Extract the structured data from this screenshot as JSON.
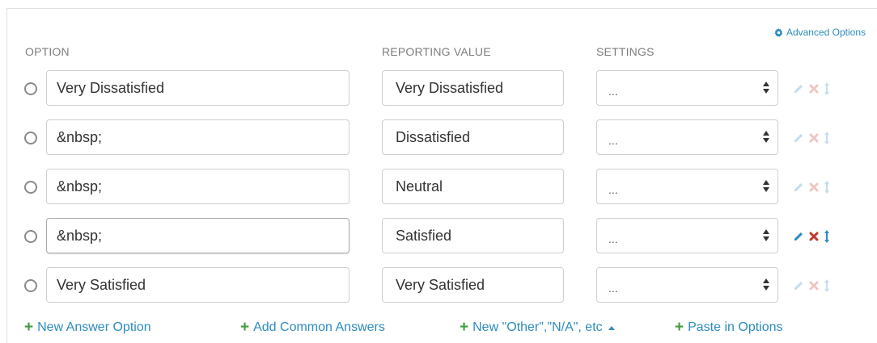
{
  "advanced_options": {
    "label": "Advanced Options",
    "icon": "gear-icon"
  },
  "columns": {
    "option": "OPTION",
    "reporting_value": "REPORTING VALUE",
    "settings": "SETTINGS"
  },
  "rows": [
    {
      "option": "Very Dissatisfied",
      "reporting_value": "Very Dissatisfied",
      "settings": "...",
      "focused": false,
      "tools_active": false
    },
    {
      "option": "&nbsp;",
      "reporting_value": "Dissatisfied",
      "settings": "...",
      "focused": false,
      "tools_active": false
    },
    {
      "option": "&nbsp;",
      "reporting_value": "Neutral",
      "settings": "...",
      "focused": false,
      "tools_active": false
    },
    {
      "option": "&nbsp;",
      "reporting_value": "Satisfied",
      "settings": "...",
      "focused": true,
      "tools_active": true
    },
    {
      "option": "Very Satisfied",
      "reporting_value": "Very Satisfied",
      "settings": "...",
      "focused": false,
      "tools_active": false
    }
  ],
  "footer": {
    "new_answer_option": "New Answer Option",
    "add_common_answers": "Add Common Answers",
    "new_other": "New \"Other\",\"N/A\", etc",
    "paste_in_options": "Paste in Options"
  },
  "colors": {
    "link": "#2d8cc0",
    "plus": "#3f9c3c",
    "edit": "#2d8cc0",
    "delete": "#c0392b"
  }
}
